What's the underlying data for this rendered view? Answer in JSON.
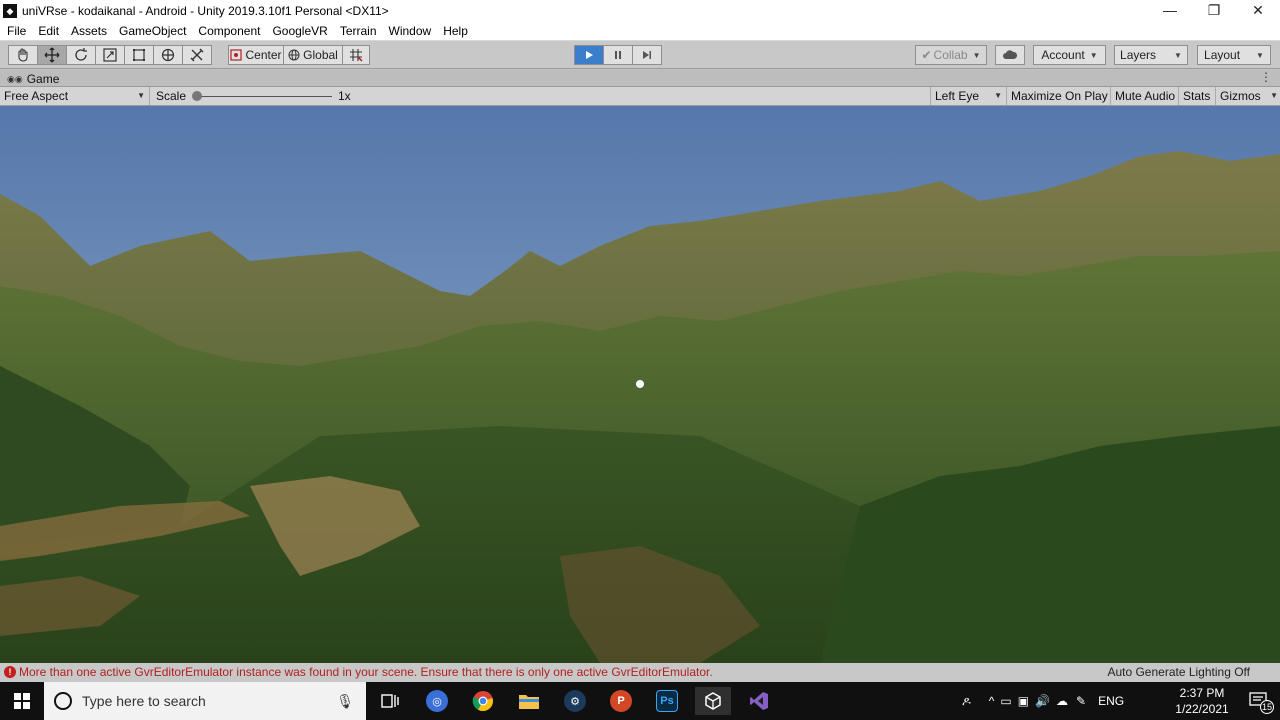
{
  "window": {
    "title": "uniVRse - kodaikanal - Android - Unity 2019.3.10f1 Personal <DX11>",
    "minimize": "—",
    "maximize": "❐",
    "close": "✕"
  },
  "menu": [
    "File",
    "Edit",
    "Assets",
    "GameObject",
    "Component",
    "GoogleVR",
    "Terrain",
    "Window",
    "Help"
  ],
  "toolbar": {
    "tools": [
      "hand-icon",
      "move-icon",
      "rotate-icon",
      "scale-icon",
      "rect-icon",
      "transform-icon",
      "custom-tool-icon"
    ],
    "pivot_label": "Center",
    "space_label": "Global",
    "collab_label": "Collab",
    "account_label": "Account",
    "layers_label": "Layers",
    "layout_label": "Layout"
  },
  "tab": {
    "label": "Game"
  },
  "gamebar": {
    "aspect": "Free Aspect",
    "scale_label": "Scale",
    "scale_value": "1x",
    "eye": "Left Eye",
    "maximize": "Maximize On Play",
    "mute": "Mute Audio",
    "stats": "Stats",
    "gizmos": "Gizmos"
  },
  "status": {
    "error_message": "More than one active GvrEditorEmulator instance was found in your scene.  Ensure that there is only one active GvrEditorEmulator.",
    "lighting": "Auto Generate Lighting Off"
  },
  "taskbar": {
    "search_placeholder": "Type here to search",
    "language": "ENG",
    "time": "2:37 PM",
    "date": "1/22/2021",
    "notification_count": "15"
  },
  "colors": {
    "play_active": "#3b7ecb",
    "error_text": "#b0211f",
    "sky": "#5c7fb0"
  }
}
